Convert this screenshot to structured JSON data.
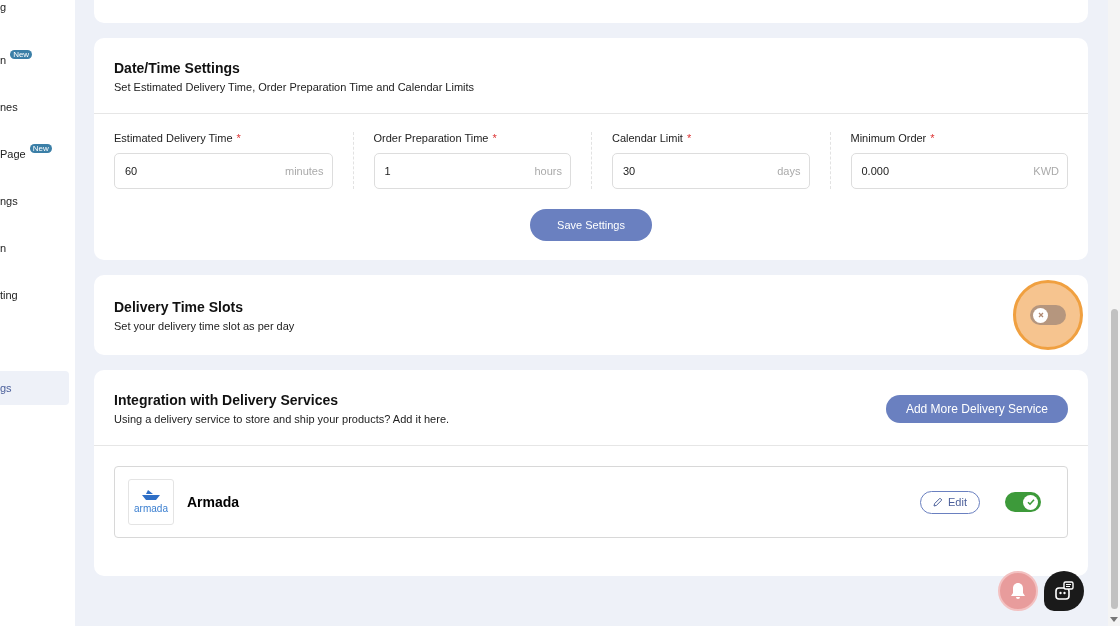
{
  "sidebar": {
    "items": [
      {
        "label": "g",
        "selected": false
      },
      {
        "label": "n",
        "badge": "New",
        "selected": false
      },
      {
        "label": "nes",
        "selected": false
      },
      {
        "label": "Page",
        "badge": "New",
        "selected": false
      },
      {
        "label": "ngs",
        "selected": false
      },
      {
        "label": "n",
        "selected": false
      },
      {
        "label": "ting",
        "selected": false
      },
      {
        "label": "gs",
        "selected": true
      }
    ]
  },
  "date_time_settings": {
    "title": "Date/Time Settings",
    "subtitle": "Set Estimated Delivery Time, Order Preparation Time and Calendar Limits",
    "fields": [
      {
        "label": "Estimated Delivery Time",
        "required_mark": "*",
        "value": "60",
        "unit": "minutes"
      },
      {
        "label": "Order Preparation Time",
        "required_mark": "*",
        "value": "1",
        "unit": "hours"
      },
      {
        "label": "Calendar Limit",
        "required_mark": "*",
        "value": "30",
        "unit": "days"
      },
      {
        "label": "Minimum Order",
        "required_mark": "*",
        "value": "0.000",
        "unit": "KWD"
      }
    ],
    "save_button": "Save Settings"
  },
  "delivery_time_slots": {
    "title": "Delivery Time Slots",
    "subtitle": "Set your delivery time slot as per day",
    "on": false,
    "highlighted": true
  },
  "integration": {
    "title": "Integration with Delivery Services",
    "subtitle": "Using a delivery service to store and ship your products? Add it here.",
    "add_button": "Add More Delivery Service",
    "services": [
      {
        "name": "Armada",
        "logo_text": "armada",
        "edit_label": "Edit",
        "on": true
      }
    ]
  }
}
